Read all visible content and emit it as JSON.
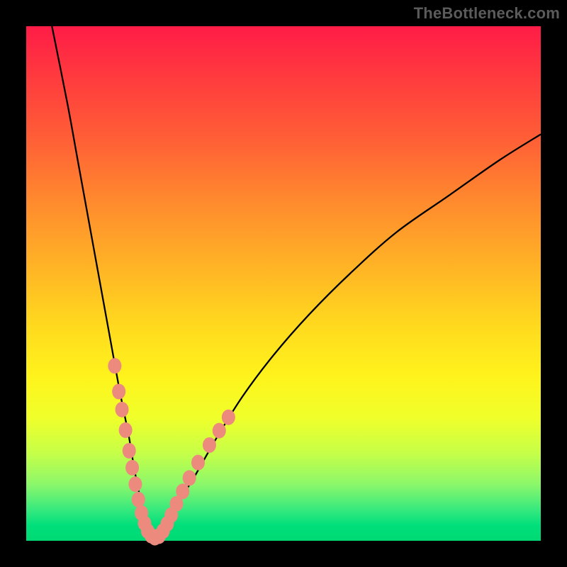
{
  "watermark": "TheBottleneck.com",
  "colors": {
    "frame": "#000000",
    "curve": "#000000",
    "dots": "#ec8a7e",
    "gradient_top": "#ff1c47",
    "gradient_bottom": "#00d973"
  },
  "chart_data": {
    "type": "line",
    "title": "",
    "xlabel": "",
    "ylabel": "",
    "xlim": [
      0,
      100
    ],
    "ylim": [
      0,
      100
    ],
    "grid": false,
    "series": [
      {
        "name": "bottleneck-curve",
        "x": [
          5,
          8,
          10,
          12,
          14,
          16,
          18,
          19,
          20,
          21,
          22,
          23,
          24,
          25,
          26,
          28,
          30,
          33,
          37,
          42,
          48,
          55,
          63,
          72,
          82,
          92,
          100
        ],
        "y": [
          100,
          85,
          74,
          63,
          52,
          41,
          30,
          25,
          20,
          14,
          9,
          5,
          2,
          0.5,
          1,
          4,
          8,
          13,
          20,
          28,
          36,
          44,
          52,
          60,
          67,
          74,
          79
        ]
      }
    ],
    "highlight_points": {
      "name": "sample-dots",
      "points": [
        {
          "x": 17.2,
          "y": 34
        },
        {
          "x": 18.0,
          "y": 29
        },
        {
          "x": 18.6,
          "y": 25.5
        },
        {
          "x": 19.3,
          "y": 21.5
        },
        {
          "x": 20.0,
          "y": 17.5
        },
        {
          "x": 20.6,
          "y": 14.2
        },
        {
          "x": 21.2,
          "y": 11.0
        },
        {
          "x": 21.8,
          "y": 8.0
        },
        {
          "x": 22.4,
          "y": 5.4
        },
        {
          "x": 23.0,
          "y": 3.4
        },
        {
          "x": 23.6,
          "y": 1.9
        },
        {
          "x": 24.3,
          "y": 1.0
        },
        {
          "x": 25.0,
          "y": 0.6
        },
        {
          "x": 25.8,
          "y": 0.9
        },
        {
          "x": 26.6,
          "y": 1.9
        },
        {
          "x": 27.4,
          "y": 3.3
        },
        {
          "x": 28.2,
          "y": 5.0
        },
        {
          "x": 29.2,
          "y": 7.2
        },
        {
          "x": 30.4,
          "y": 9.6
        },
        {
          "x": 31.7,
          "y": 12.2
        },
        {
          "x": 33.4,
          "y": 15.2
        },
        {
          "x": 35.6,
          "y": 18.6
        },
        {
          "x": 37.5,
          "y": 21.4
        },
        {
          "x": 39.3,
          "y": 24.0
        }
      ]
    }
  }
}
